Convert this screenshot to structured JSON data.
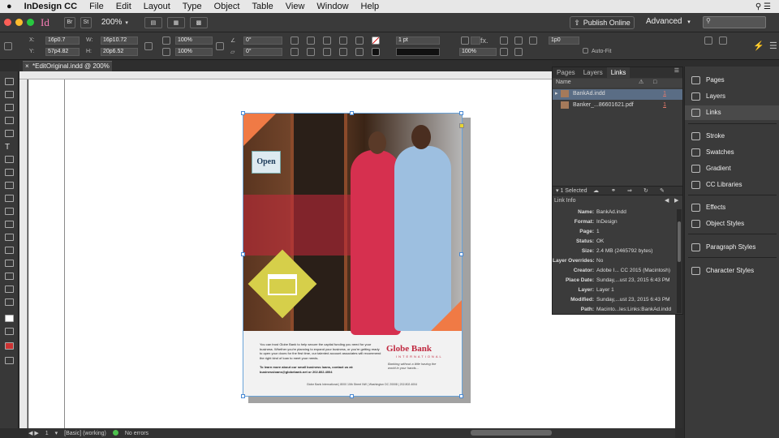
{
  "menubar": {
    "apple": "",
    "app": "InDesign CC",
    "items": [
      "File",
      "Edit",
      "Layout",
      "Type",
      "Object",
      "Table",
      "View",
      "Window",
      "Help"
    ]
  },
  "appbar": {
    "logo": "Id",
    "br": "Br",
    "st": "St",
    "zoom": "200%",
    "publish": "Publish Online",
    "workspace": "Advanced"
  },
  "control": {
    "x_label": "X:",
    "x_value": "16p0.7",
    "y_label": "Y:",
    "y_value": "57p4.82",
    "w_label": "W:",
    "w_value": "16p10.72",
    "h_label": "H:",
    "h_value": "20p6.52",
    "scale_x": "100%",
    "scale_y": "100%",
    "angle": "0°",
    "shear": "0°",
    "stroke_weight": "1 pt",
    "opacity": "100%",
    "offset": "1p0",
    "autofit": "Auto-Fit"
  },
  "document": {
    "tab_title": "*EditOriginal.indd @ 200%"
  },
  "ad": {
    "open_sign": "Open",
    "body": "You can trust Globe Bank to help secure the capital funding you need for your business. Whether you're planning to expand your business, or you're getting ready to open your doors for the first time, our talented account associates will recommend the right kind of loan to meet your needs.",
    "contact": "To learn more about our small business loans, contact us at: businessloans@globebank.net or 202.802.4004",
    "brand": "Globe Bank",
    "brand_sub": "INTERNATIONAL",
    "tagline": "Banking without a little having the world in your hands...",
    "footer": "Globe Bank International | 8000 10th Street NW | Washington DC 20008 | 202.802.4004"
  },
  "status": {
    "page": "1",
    "style": "[Basic] (working)",
    "errors": "No errors"
  },
  "links_panel": {
    "tabs": [
      "Pages",
      "Layers",
      "Links"
    ],
    "header_name": "Name",
    "links": [
      {
        "name": "BankAd.indd",
        "page": "1"
      },
      {
        "name": "Banker_...86601621.pdf",
        "page": "1"
      }
    ],
    "selected": "1 Selected",
    "info_title": "Link Info",
    "info": [
      {
        "k": "Name:",
        "v": "BankAd.indd"
      },
      {
        "k": "Format:",
        "v": "InDesign"
      },
      {
        "k": "Page:",
        "v": "1"
      },
      {
        "k": "Status:",
        "v": "OK"
      },
      {
        "k": "Size:",
        "v": "2.4 MB (2465792 bytes)"
      },
      {
        "k": "Layer Overrides:",
        "v": "No"
      },
      {
        "k": "Creator:",
        "v": "Adobe I... CC 2015 (Macintosh)"
      },
      {
        "k": "Place Date:",
        "v": "Sunday,...ust 23, 2015 6:43 PM"
      },
      {
        "k": "Layer:",
        "v": "Layer 1"
      },
      {
        "k": "Modified:",
        "v": "Sunday,...ust 23, 2015 6:43 PM"
      },
      {
        "k": "Path:",
        "v": "Macinto...les:Links:BankAd.indd"
      }
    ]
  },
  "dock": {
    "items": [
      "Pages",
      "Layers",
      "Links",
      "Stroke",
      "Swatches",
      "Gradient",
      "CC Libraries",
      "Effects",
      "Object Styles",
      "Paragraph Styles",
      "Character Styles"
    ]
  },
  "colors": {
    "accent": "#f77db6",
    "brand": "#c0283f",
    "selection": "#4a8ad4"
  }
}
